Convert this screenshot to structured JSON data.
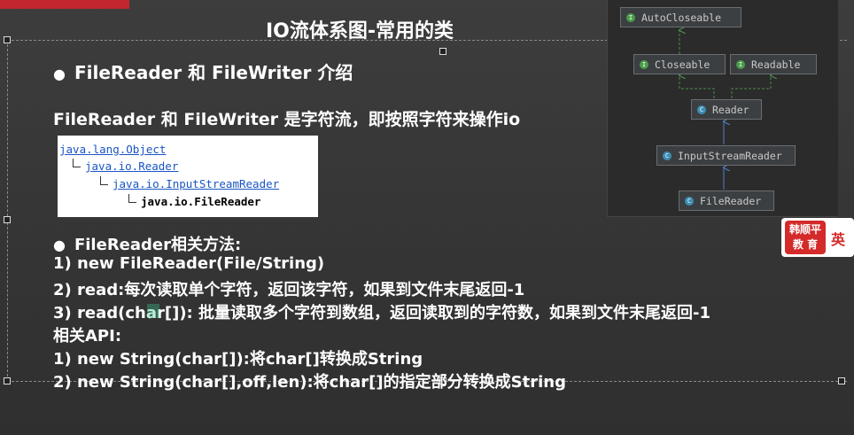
{
  "slide": {
    "title": "IO流体系图-常用的类",
    "section1_heading": "FileReader 和 FileWriter 介绍",
    "section1_text": "FileReader 和 FileWriter 是字符流，即按照字符来操作io",
    "hierarchy": [
      "java.lang.Object",
      "java.io.Reader",
      "java.io.InputStreamReader",
      "java.io.FileReader"
    ],
    "section2_heading": "FileReader相关方法:",
    "methods": [
      "1) new FileReader(File/String)",
      "2) read:每次读取单个字符，返回该字符，如果到文件末尾返回-1",
      "3) read(char[]): 批量读取多个字符到数组，返回读取到的字符数，如果到文件末尾返回-1"
    ],
    "api_heading": "相关API:",
    "api": [
      "1) new String(char[]):将char[]转换成String",
      "2) new String(char[],off,len):将char[]的指定部分转换成String"
    ]
  },
  "diagram": {
    "nodes": [
      {
        "label": "AutoCloseable",
        "icon": "interface-icon"
      },
      {
        "label": "Closeable",
        "icon": "interface-icon"
      },
      {
        "label": "Readable",
        "icon": "interface-icon"
      },
      {
        "label": "Reader",
        "icon": "abstract-class-icon"
      },
      {
        "label": "InputStreamReader",
        "icon": "class-icon"
      },
      {
        "label": "FileReader",
        "icon": "class-icon"
      }
    ]
  },
  "logo": {
    "line1": "韩顺平",
    "line2": "教 育",
    "side": "英"
  },
  "colors": {
    "background": "#3a3a3a",
    "diagram_bg": "#2b2b2b",
    "brand_red": "#d42a2a",
    "link_blue": "#1a55c4"
  }
}
